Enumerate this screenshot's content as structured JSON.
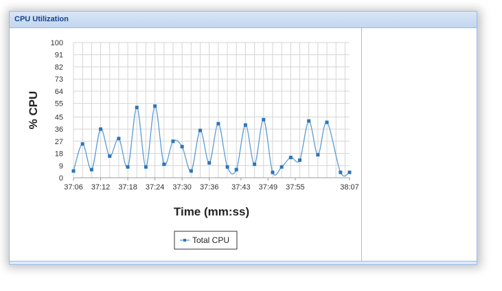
{
  "panel": {
    "title": "CPU Utilization"
  },
  "chart_data": {
    "type": "line",
    "title": "",
    "xlabel": "Time (mm:ss)",
    "ylabel": "% CPU",
    "ylim": [
      0,
      100
    ],
    "y_ticks": [
      "0",
      "9",
      "18",
      "27",
      "36",
      "45",
      "55",
      "64",
      "73",
      "82",
      "91",
      "100"
    ],
    "x_ticks": [
      "37:06",
      "37:12",
      "37:18",
      "37:24",
      "37:30",
      "37:36",
      "37:43",
      "37:49",
      "37:55",
      "38:07"
    ],
    "xlim_seconds": [
      2226,
      2287
    ],
    "grid": true,
    "legend": "bottom-center",
    "series": [
      {
        "name": "Total CPU",
        "color": "#5b9bd5",
        "x": [
          "37:06",
          "37:08",
          "37:10",
          "37:12",
          "37:14",
          "37:16",
          "37:18",
          "37:20",
          "37:22",
          "37:24",
          "37:26",
          "37:28",
          "37:30",
          "37:32",
          "37:34",
          "37:36",
          "37:38",
          "37:40",
          "37:42",
          "37:44",
          "37:46",
          "37:48",
          "37:50",
          "37:52",
          "37:54",
          "37:56",
          "37:58",
          "38:00",
          "38:02",
          "38:05",
          "38:07"
        ],
        "values": [
          5,
          25,
          6,
          36,
          16,
          29,
          8,
          52,
          8,
          53,
          10,
          27,
          23,
          5,
          35,
          11,
          40,
          8,
          6,
          39,
          10,
          43,
          4,
          8,
          15,
          13,
          42,
          17,
          41,
          4,
          4
        ]
      }
    ]
  }
}
